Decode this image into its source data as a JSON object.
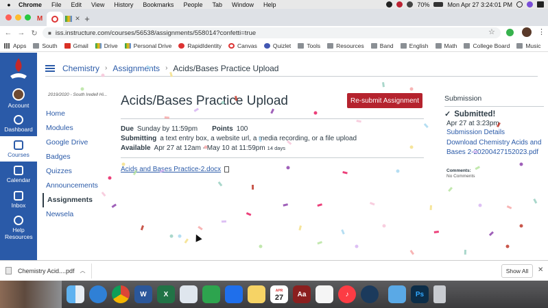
{
  "menubar": {
    "app": "Chrome",
    "items": [
      "File",
      "Edit",
      "View",
      "History",
      "Bookmarks",
      "People",
      "Tab",
      "Window",
      "Help"
    ],
    "battery": "70%",
    "datetime": "Mon Apr 27  3:24:01 PM"
  },
  "browser": {
    "new_tab_symbol": "+",
    "url": "iss.instructure.com/courses/56538/assignments/558014?confetti=true"
  },
  "bookmarks": [
    {
      "label": "Apps",
      "icon": "grid"
    },
    {
      "label": "South",
      "icon": "folder"
    },
    {
      "label": "Gmail",
      "icon": "gmail"
    },
    {
      "label": "Drive",
      "icon": "drive"
    },
    {
      "label": "Personal Drive",
      "icon": "drive"
    },
    {
      "label": "RapidIdentity",
      "icon": "red"
    },
    {
      "label": "Canvas",
      "icon": "canvas"
    },
    {
      "label": "Quizlet",
      "icon": "q"
    },
    {
      "label": "Tools",
      "icon": "folder"
    },
    {
      "label": "Resources",
      "icon": "folder"
    },
    {
      "label": "Band",
      "icon": "folder"
    },
    {
      "label": "English",
      "icon": "folder"
    },
    {
      "label": "Math",
      "icon": "folder"
    },
    {
      "label": "College Board",
      "icon": "folder"
    },
    {
      "label": "Music",
      "icon": "folder"
    }
  ],
  "global_nav": {
    "account": "Account",
    "dashboard": "Dashboard",
    "courses": "Courses",
    "calendar": "Calendar",
    "inbox": "Inbox",
    "help": "Help Resources"
  },
  "breadcrumb": {
    "course": "Chemistry",
    "section": "Assignments",
    "current": "Acids/Bases Practice Upload",
    "sep": "›"
  },
  "course_nav": {
    "term": "2019/2020 - South Iredell Hi...",
    "items": [
      "Home",
      "Modules",
      "Google Drive",
      "Badges",
      "Quizzes",
      "Announcements",
      "Assignments",
      "Newsela"
    ]
  },
  "assignment": {
    "title": "Acids/Bases Practice Upload",
    "resubmit_label": "Re-submit Assignment",
    "due_label": "Due",
    "due_value": "Sunday by 11:59pm",
    "points_label": "Points",
    "points_value": "100",
    "submitting_label": "Submitting",
    "submitting_value": "a text entry box, a website url, a media recording, or a file upload",
    "available_label": "Available",
    "available_value": "Apr 27 at 12am - May 10 at 11:59pm",
    "available_days": "14 days",
    "file_link": "Acids and Bases Practice-2.docx"
  },
  "submission": {
    "heading": "Submission",
    "status": "Submitted!",
    "date": "Apr 27 at 3:23pm",
    "details_link": "Submission Details",
    "download_link": "Download Chemistry Acids and Bases 2-20200427152023.pdf",
    "comments_heading": "Comments:",
    "comments_text": "No Comments"
  },
  "download_bar": {
    "file": "Chemistry Acid....pdf",
    "show_all": "Show All"
  },
  "dock": {
    "calendar_month": "APR",
    "calendar_day": "27",
    "photoshop": "Ps"
  },
  "colors": {
    "canvas_blue": "#2a5aa8",
    "resubmit_red": "#b5232e",
    "text": "#2d3b45"
  }
}
